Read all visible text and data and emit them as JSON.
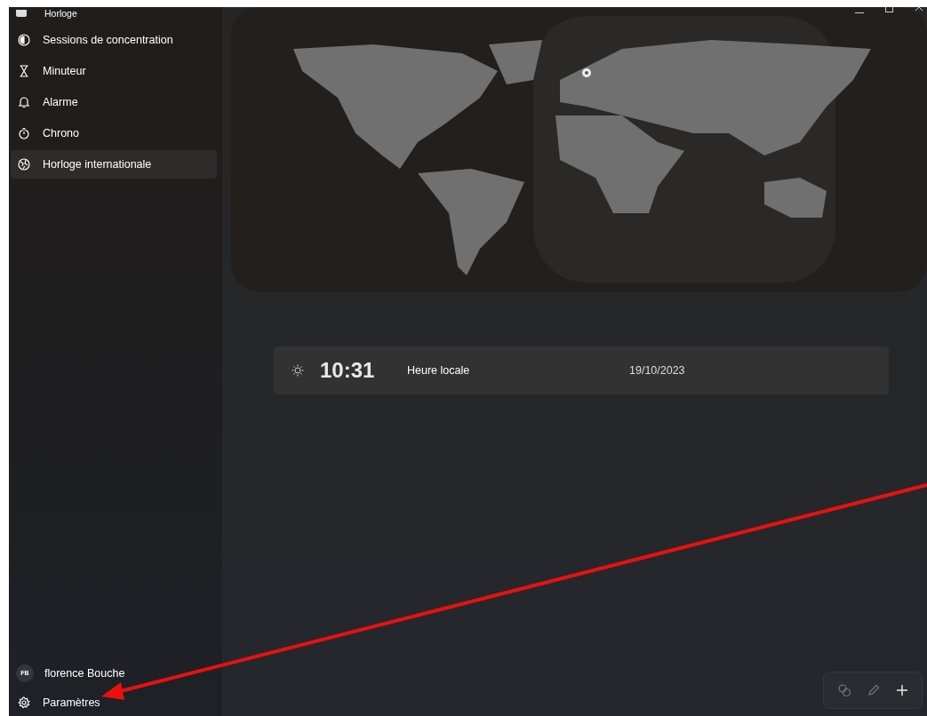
{
  "window": {
    "title": "Horloge"
  },
  "nav_items": [
    {
      "kind": "focus",
      "label": "Sessions de concentration",
      "selected": false
    },
    {
      "kind": "timer",
      "label": "Minuteur",
      "selected": false
    },
    {
      "kind": "alarm",
      "label": "Alarme",
      "selected": false
    },
    {
      "kind": "stopwatch",
      "label": "Chrono",
      "selected": false
    },
    {
      "kind": "world",
      "label": "Horloge internationale",
      "selected": true
    }
  ],
  "account": {
    "initials": "FB",
    "name": "florence Bouche"
  },
  "settings": {
    "label": "Paramètres"
  },
  "clocks": [
    {
      "time": "10:31",
      "label": "Heure locale",
      "date": "19/10/2023"
    }
  ]
}
